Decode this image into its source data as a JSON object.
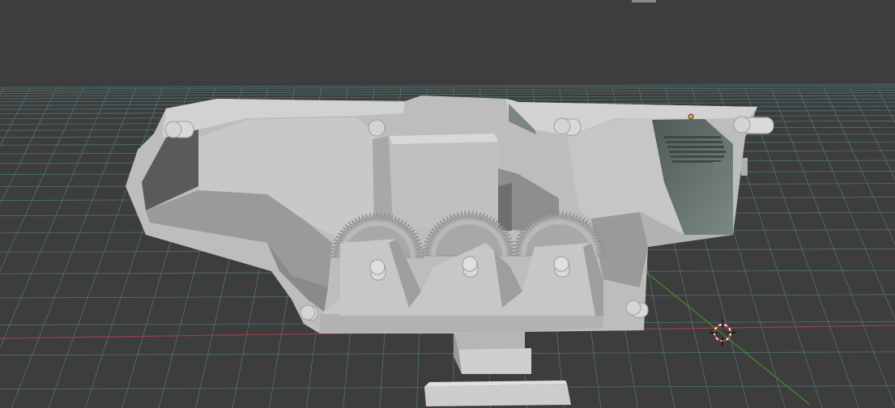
{
  "viewport": {
    "view": "perspective",
    "background_color": "#3d3d3d",
    "grid_color": "#4e7474",
    "x_axis_color": "#9b3f4a",
    "y_axis_color": "#3f8f2a"
  },
  "scene": {
    "objects": [
      {
        "name": "gearbox-housing",
        "color": "#b9b9b9"
      },
      {
        "name": "gear-left",
        "color": "#a8a8a8"
      },
      {
        "name": "gear-middle",
        "color": "#a8a8a8"
      },
      {
        "name": "gear-right",
        "color": "#a8a8a8"
      },
      {
        "name": "mount-block-upper",
        "color": "#b5b5b5"
      },
      {
        "name": "mount-block-lower",
        "color": "#b5b5b5"
      }
    ],
    "selected_origin_color": "#f0a020",
    "cursor_icon": "3d-cursor-icon"
  }
}
